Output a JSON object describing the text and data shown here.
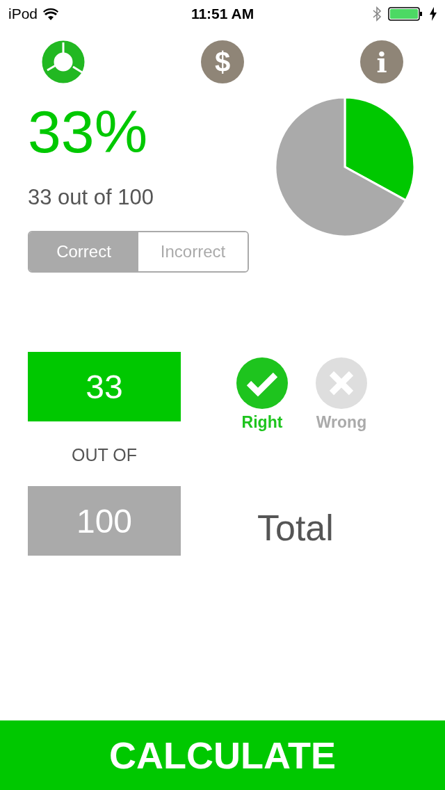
{
  "status_bar": {
    "carrier": "iPod",
    "time": "11:51 AM"
  },
  "toolbar": {
    "icons": [
      {
        "kind": "logo"
      },
      {
        "kind": "dollar",
        "label": "$"
      },
      {
        "kind": "info",
        "label": "i"
      }
    ]
  },
  "result": {
    "percent": "33%",
    "summary": "33 out of 100"
  },
  "mode_tabs": [
    {
      "label": "Correct",
      "selected": true
    },
    {
      "label": "Incorrect",
      "selected": false
    }
  ],
  "chart": {
    "chart_data": {
      "type": "pie",
      "values": [
        33,
        67
      ]
    }
  },
  "score_field": {
    "value": "33"
  },
  "answer_toggle": [
    {
      "label": "Right",
      "kind": "right",
      "selected": true
    },
    {
      "label": "Wrong",
      "kind": "wrong",
      "selected": false
    }
  ],
  "separator_label": "OUT OF",
  "total_field": {
    "value": "100"
  },
  "total_label": "Total",
  "calculate_button": {
    "label": "CALCULATE"
  }
}
